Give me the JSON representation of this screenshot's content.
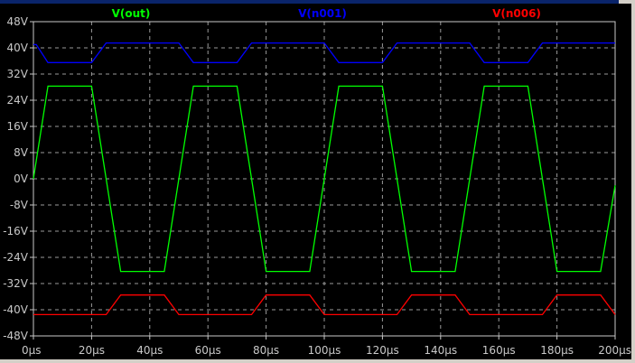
{
  "chart_data": {
    "type": "line",
    "x_unit": "µs",
    "xlim": [
      0,
      200
    ],
    "ylim": [
      -48,
      48
    ],
    "grid": true,
    "legend_position": "top",
    "x_ticks": [
      "0µs",
      "20µs",
      "40µs",
      "60µs",
      "80µs",
      "100µs",
      "120µs",
      "140µs",
      "160µs",
      "180µs",
      "200µs"
    ],
    "y_ticks": [
      "48V",
      "40V",
      "32V",
      "24V",
      "16V",
      "8V",
      "0V",
      "-8V",
      "-16V",
      "-24V",
      "-32V",
      "-40V",
      "-48V"
    ],
    "colors": {
      "background": "#000000",
      "grid": "#9a9a9a",
      "axis": "#c8c8c8"
    },
    "series": [
      {
        "name": "V(out)",
        "color": "#00ff00",
        "x": [
          0,
          5,
          20,
          30,
          45,
          55,
          70,
          80,
          95,
          105,
          120,
          130,
          145,
          155,
          170,
          180,
          195,
          200
        ],
        "y": [
          0,
          28.3,
          28.3,
          -28.3,
          -28.3,
          28.3,
          28.3,
          -28.3,
          -28.3,
          28.3,
          28.3,
          -28.3,
          -28.3,
          28.3,
          28.3,
          -28.3,
          -28.3,
          -2
        ]
      },
      {
        "name": "V(n001)",
        "color": "#0000ff",
        "x": [
          0,
          1,
          5,
          20,
          25,
          50,
          55,
          70,
          75,
          100,
          105,
          120,
          125,
          150,
          155,
          170,
          175,
          200
        ],
        "y": [
          41,
          41,
          35.5,
          35.5,
          41.5,
          41.5,
          35.5,
          35.5,
          41.5,
          41.5,
          35.5,
          35.5,
          41.5,
          41.5,
          35.5,
          35.5,
          41.5,
          41.5
        ]
      },
      {
        "name": "V(n006)",
        "color": "#ff0000",
        "x": [
          0,
          25,
          30,
          45,
          50,
          75,
          80,
          95,
          100,
          125,
          130,
          145,
          150,
          175,
          180,
          195,
          200
        ],
        "y": [
          -41.5,
          -41.5,
          -35.5,
          -35.5,
          -41.5,
          -41.5,
          -35.5,
          -35.5,
          -41.5,
          -41.5,
          -35.5,
          -35.5,
          -41.5,
          -41.5,
          -35.5,
          -35.5,
          -41.5
        ]
      }
    ]
  }
}
